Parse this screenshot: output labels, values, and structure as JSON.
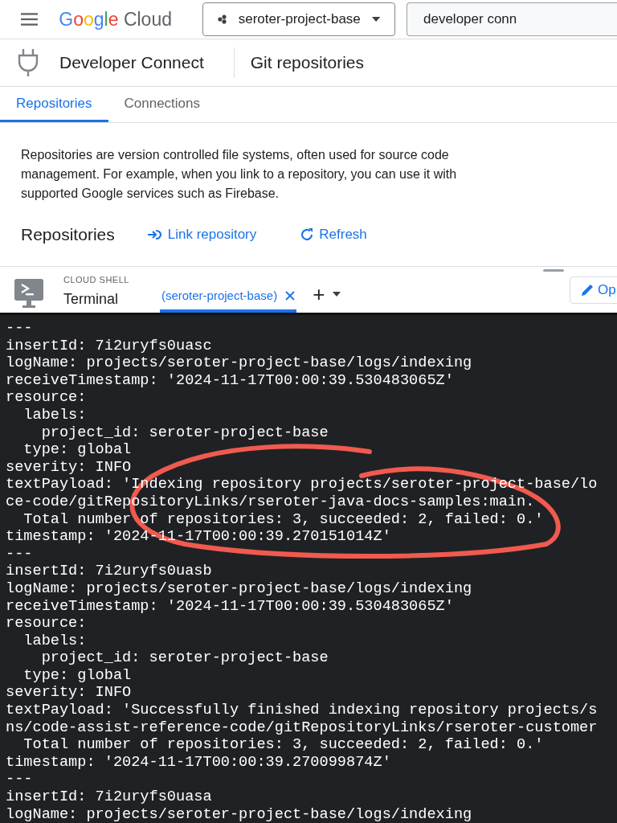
{
  "header": {
    "logo": "Google",
    "product": "Cloud",
    "project": "seroter-project-base",
    "search": {
      "value": "developer conn"
    }
  },
  "product_bar": {
    "title": "Developer Connect",
    "page": "Git repositories"
  },
  "tabs": [
    {
      "label": "Repositories",
      "selected": true
    },
    {
      "label": "Connections",
      "selected": false
    }
  ],
  "description": "Repositories are version controlled file systems, often used for source code management. For example, when you link to a repository, you can use it with supported Google services such as Firebase.",
  "section": {
    "title": "Repositories",
    "actions": [
      {
        "kind": "link",
        "label": "Link repository"
      },
      {
        "kind": "refresh",
        "label": "Refresh"
      }
    ]
  },
  "cloud_shell": {
    "eyebrow": "CLOUD SHELL",
    "title": "Terminal",
    "session_tab": {
      "label": "(seroter-project-base)",
      "selected": true
    },
    "add": "+",
    "open_button": "Op",
    "lines": [
      "---",
      "insertId: 7i2uryfs0uasc",
      "logName: projects/seroter-project-base/logs/indexing",
      "receiveTimestamp: '2024-11-17T00:00:39.530483065Z'",
      "resource:",
      "  labels:",
      "    project_id: seroter-project-base",
      "  type: global",
      "severity: INFO",
      "textPayload: 'Indexing repository projects/seroter-project-base/lo",
      "ce-code/gitRepositoryLinks/rseroter-java-docs-samples:main.",
      "  Total number of repositories: 3, succeeded: 2, failed: 0.'",
      "timestamp: '2024-11-17T00:00:39.270151014Z'",
      "---",
      "insertId: 7i2uryfs0uasb",
      "logName: projects/seroter-project-base/logs/indexing",
      "receiveTimestamp: '2024-11-17T00:00:39.530483065Z'",
      "resource:",
      "  labels:",
      "    project_id: seroter-project-base",
      "  type: global",
      "severity: INFO",
      "textPayload: 'Successfully finished indexing repository projects/s",
      "ns/code-assist-reference-code/gitRepositoryLinks/rseroter-customer",
      "  Total number of repositories: 3, succeeded: 2, failed: 0.'",
      "timestamp: '2024-11-17T00:00:39.270099874Z'",
      "---",
      "insertId: 7i2uryfs0uasa",
      "logName: projects/seroter-project-base/logs/indexing"
    ]
  }
}
